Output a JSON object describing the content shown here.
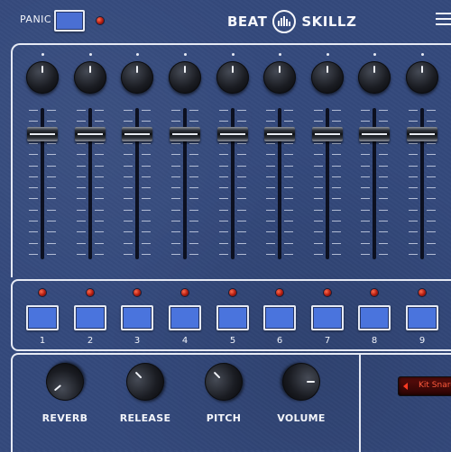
{
  "header": {
    "panic_label": "PANIC",
    "brand_left": "BEAT",
    "brand_right": "SKILLZ",
    "logo_icon": "equalizer-bars-icon",
    "menu_icon": "hamburger-menu-icon"
  },
  "channels": [
    {
      "pad_number": "1"
    },
    {
      "pad_number": "2"
    },
    {
      "pad_number": "3"
    },
    {
      "pad_number": "4"
    },
    {
      "pad_number": "5"
    },
    {
      "pad_number": "6"
    },
    {
      "pad_number": "7"
    },
    {
      "pad_number": "8"
    },
    {
      "pad_number": "9"
    }
  ],
  "master_knobs": [
    {
      "label": "REVERB",
      "angle": -130
    },
    {
      "label": "RELEASE",
      "angle": -45
    },
    {
      "label": "PITCH",
      "angle": -45
    },
    {
      "label": "VOLUME",
      "angle": 90
    }
  ],
  "kit": {
    "display_text": "Kit Snare"
  },
  "colors": {
    "panel_bg": "#34497c",
    "pad_blue": "#4a74dd",
    "led_red": "#c0281a",
    "display_red": "#ff5a3c"
  }
}
